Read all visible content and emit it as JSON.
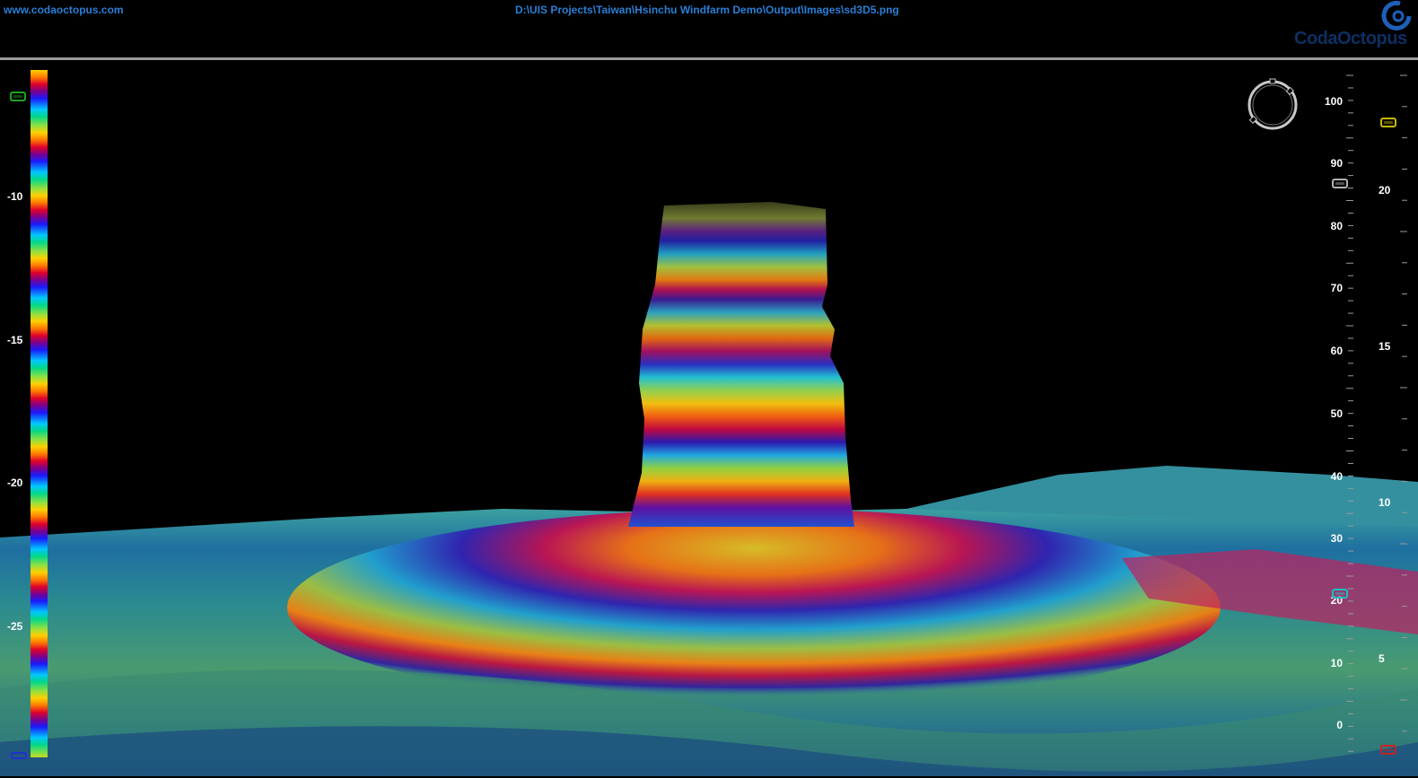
{
  "header": {
    "site_url": "www.codaoctopus.com",
    "file_path": "D:\\UIS Projects\\Taiwan\\Hsinchu Windfarm Demo\\Output\\Images\\sd3D5.png",
    "logo_text": "CodaOctopus"
  },
  "colors": {
    "link": "#2a7fd6",
    "logo": "#0d2f63",
    "divider": "#9a9a9a",
    "marker_green": "#1fa31f",
    "marker_yellow": "#c8b800",
    "marker_gray": "#b0b0b0",
    "marker_cyan": "#19c0c0",
    "marker_red": "#d02020",
    "marker_blue": "#2030d0"
  },
  "depth_scale": {
    "labels": [
      "-10",
      "-15",
      "-20",
      "-25"
    ]
  },
  "right_scale_inner": {
    "labels": [
      "100",
      "90",
      "80",
      "70",
      "60",
      "50",
      "40",
      "30",
      "20",
      "10",
      "0"
    ]
  },
  "right_scale_outer": {
    "labels": [
      "20",
      "15",
      "10",
      "5"
    ]
  },
  "icons": {
    "compass": "rotate-compass-icon",
    "logo": "coda-octopus-logo-icon"
  }
}
